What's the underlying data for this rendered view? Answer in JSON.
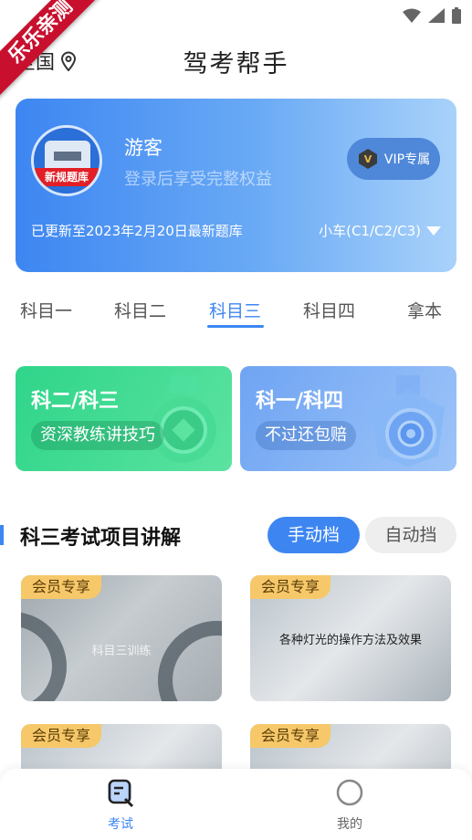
{
  "ribbon": "乐乐亲测",
  "header": {
    "location": "全国",
    "title": "驾考帮手"
  },
  "user": {
    "avatar_label": "新规题库",
    "name": "游客",
    "subtitle": "登录后享受完整权益",
    "vip_label": "VIP专属",
    "update_text": "已更新至2023年2月20日最新题库",
    "car_type": "小车(C1/C2/C3)"
  },
  "tabs": [
    {
      "label": "科目一",
      "active": false
    },
    {
      "label": "科目二",
      "active": false
    },
    {
      "label": "科目三",
      "active": true
    },
    {
      "label": "科目四",
      "active": false
    },
    {
      "label": "拿本",
      "active": false
    }
  ],
  "promos": [
    {
      "title": "科二/科三",
      "pill": "资深教练讲技巧"
    },
    {
      "title": "科一/科四",
      "pill": "不过还包赔"
    }
  ],
  "section": {
    "title": "科三考试项目讲解",
    "manual_label": "手动档",
    "auto_label": "自动挡"
  },
  "videos": [
    {
      "badge": "会员专享",
      "caption": "科目三训练"
    },
    {
      "badge": "会员专享",
      "caption": "各种灯光的操作方法及效果"
    },
    {
      "badge": "会员专享",
      "caption": ""
    },
    {
      "badge": "会员专享",
      "caption": ""
    }
  ],
  "nav": {
    "exam_label": "考试",
    "mine_label": "我的"
  },
  "colors": {
    "accent": "#3d86f2",
    "green": "#2fd58a",
    "badge": "#f6c86a",
    "ribbon": "#c8102e"
  }
}
